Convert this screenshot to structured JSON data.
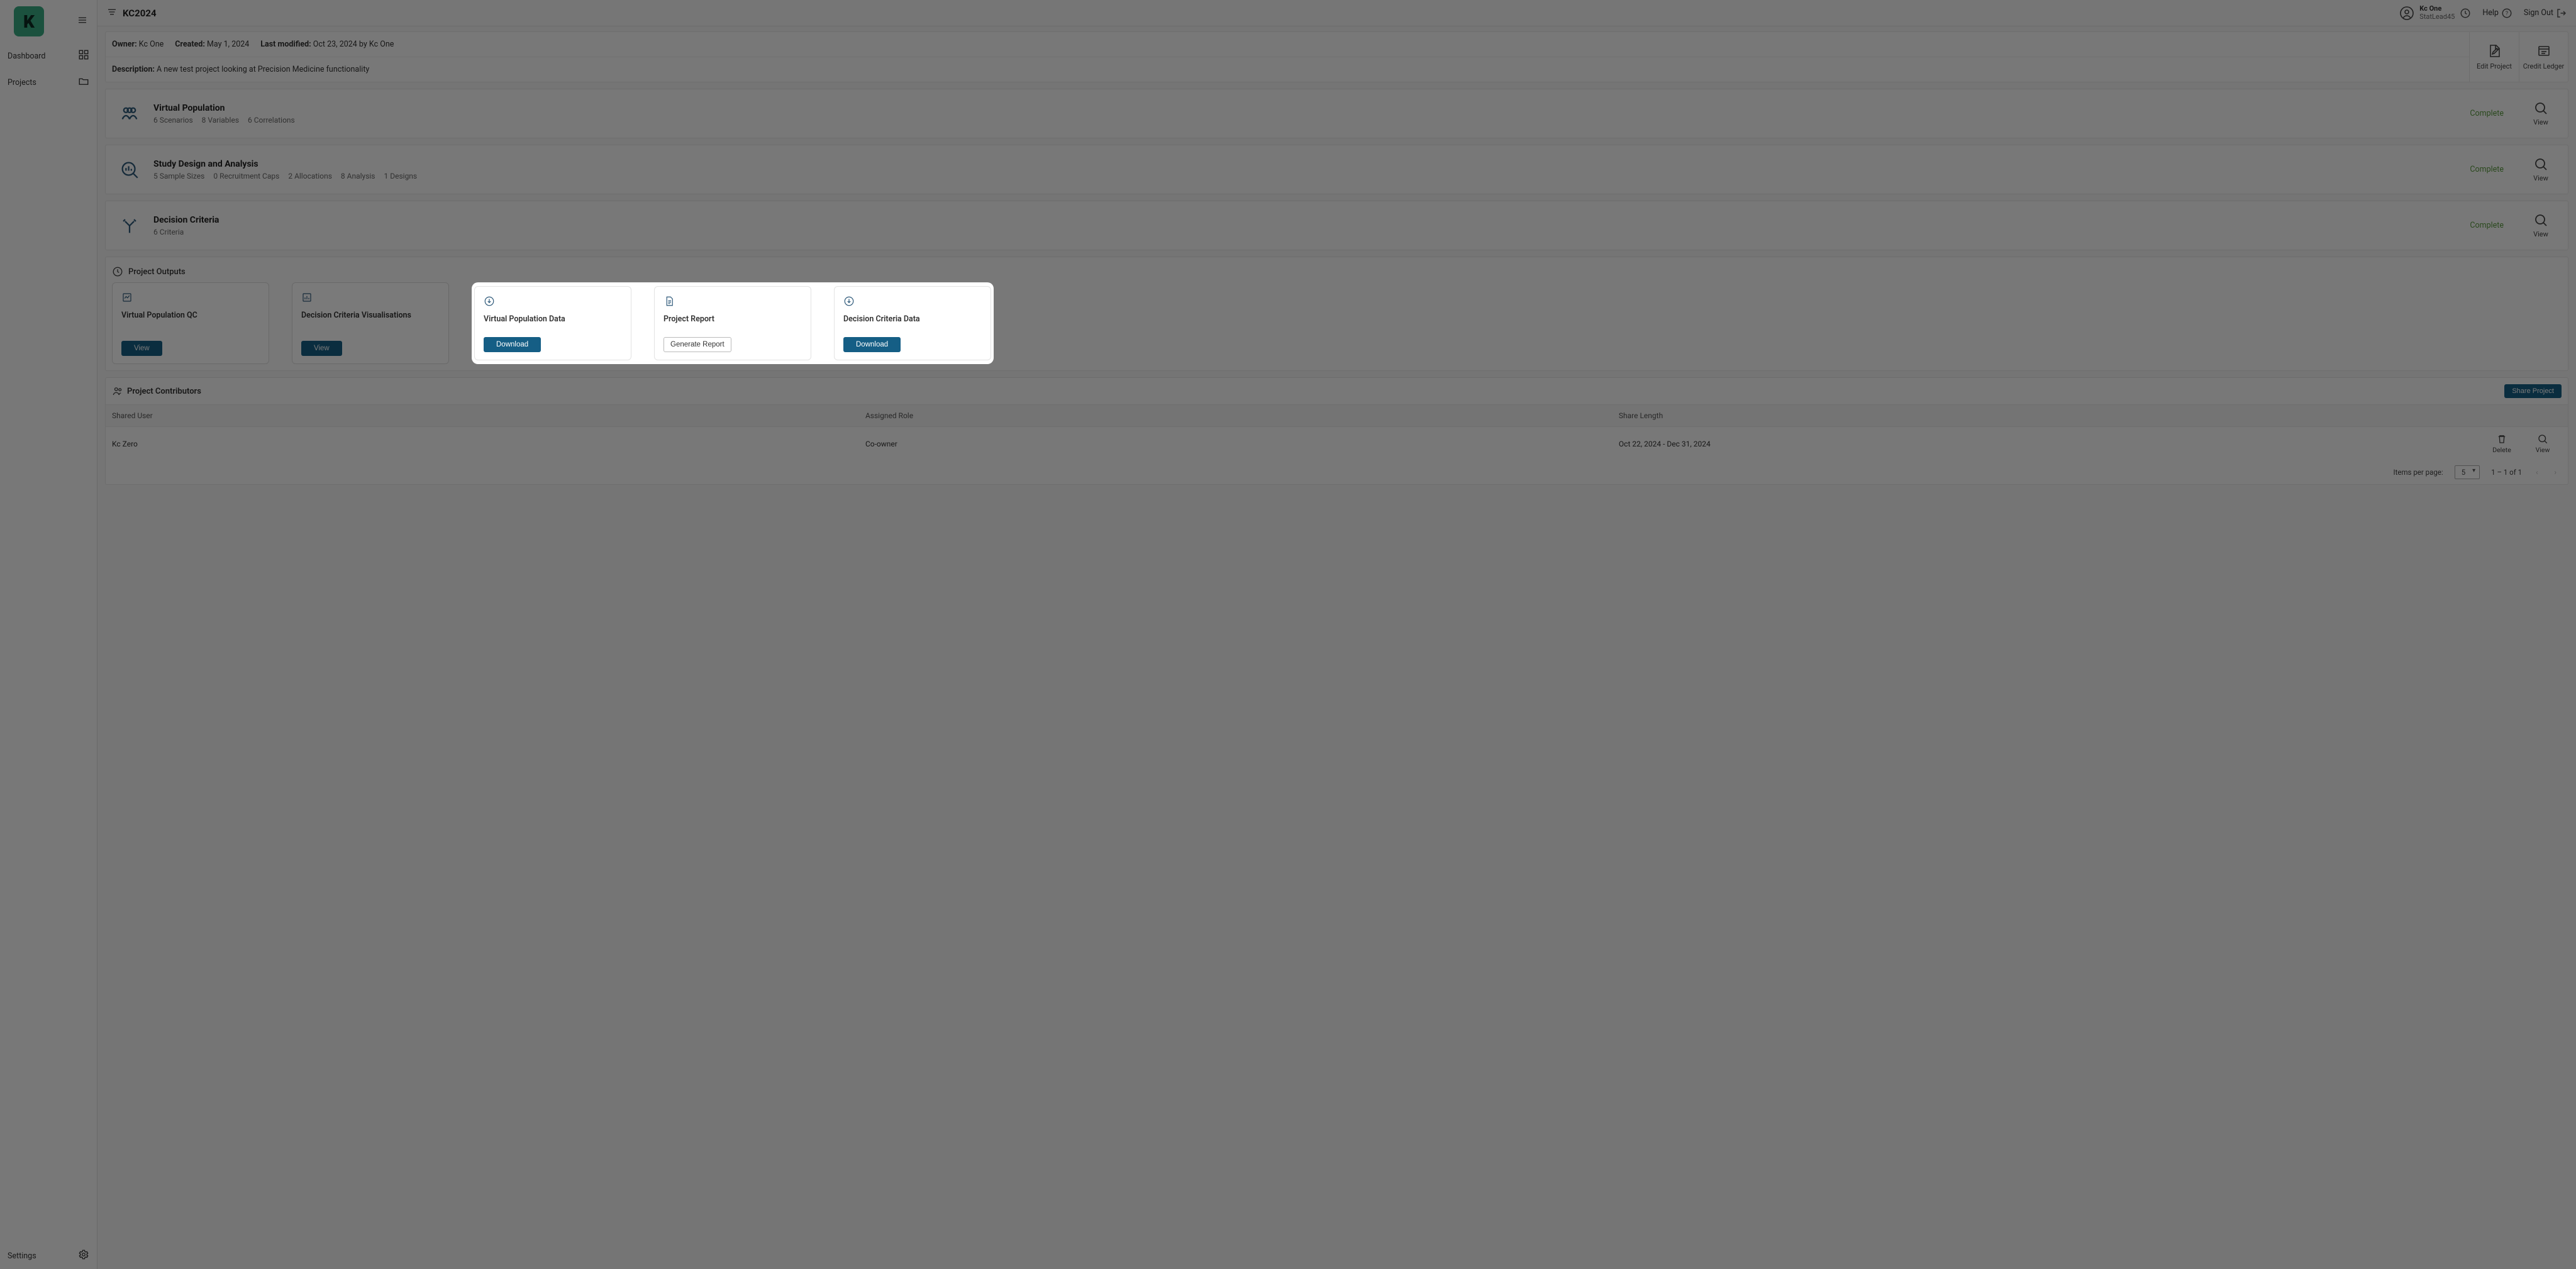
{
  "sidebar": {
    "items": [
      {
        "label": "Dashboard"
      },
      {
        "label": "Projects"
      }
    ],
    "settings_label": "Settings"
  },
  "header": {
    "project_title": "KC2024",
    "user_name": "Kc One",
    "user_role": "StatLead45",
    "help_label": "Help",
    "signout_label": "Sign Out"
  },
  "meta": {
    "owner_label": "Owner:",
    "owner_value": "Kc One",
    "created_label": "Created:",
    "created_value": "May 1, 2024",
    "modified_label": "Last modified:",
    "modified_value": "Oct 23, 2024 by Kc One",
    "description_label": "Description:",
    "description_value": "A new test project looking at Precision Medicine functionality",
    "edit_project_label": "Edit Project",
    "credit_ledger_label": "Credit Ledger"
  },
  "sections": [
    {
      "title": "Virtual Population",
      "status": "Complete",
      "subs": [
        "6 Scenarios",
        "8 Variables",
        "6 Correlations"
      ],
      "view_label": "View"
    },
    {
      "title": "Study Design and Analysis",
      "status": "Complete",
      "subs": [
        "5 Sample Sizes",
        "0 Recruitment Caps",
        "2 Allocations",
        "8 Analysis",
        "1 Designs"
      ],
      "view_label": "View"
    },
    {
      "title": "Decision Criteria",
      "status": "Complete",
      "subs": [
        "6 Criteria"
      ],
      "view_label": "View"
    }
  ],
  "outputs": {
    "header": "Project Outputs",
    "cards": [
      {
        "title": "Virtual Population QC",
        "button": "View",
        "style": "primary"
      },
      {
        "title": "Decision Criteria Visualisations",
        "button": "View",
        "style": "primary"
      },
      {
        "title": "Virtual Population Data",
        "button": "Download",
        "style": "primary"
      },
      {
        "title": "Project Report",
        "button": "Generate Report",
        "style": "outline"
      },
      {
        "title": "Decision Criteria Data",
        "button": "Download",
        "style": "primary"
      }
    ]
  },
  "contributors": {
    "header": "Project Contributors",
    "share_button": "Share Project",
    "columns": {
      "user": "Shared User",
      "role": "Assigned Role",
      "length": "Share Length"
    },
    "rows": [
      {
        "user": "Kc Zero",
        "role": "Co-owner",
        "length": "Oct 22, 2024 - Dec 31, 2024"
      }
    ],
    "delete_label": "Delete",
    "view_label": "View"
  },
  "pagination": {
    "items_per_page_label": "Items per page:",
    "items_per_page_value": "5",
    "range_text": "1 – 1 of 1"
  }
}
